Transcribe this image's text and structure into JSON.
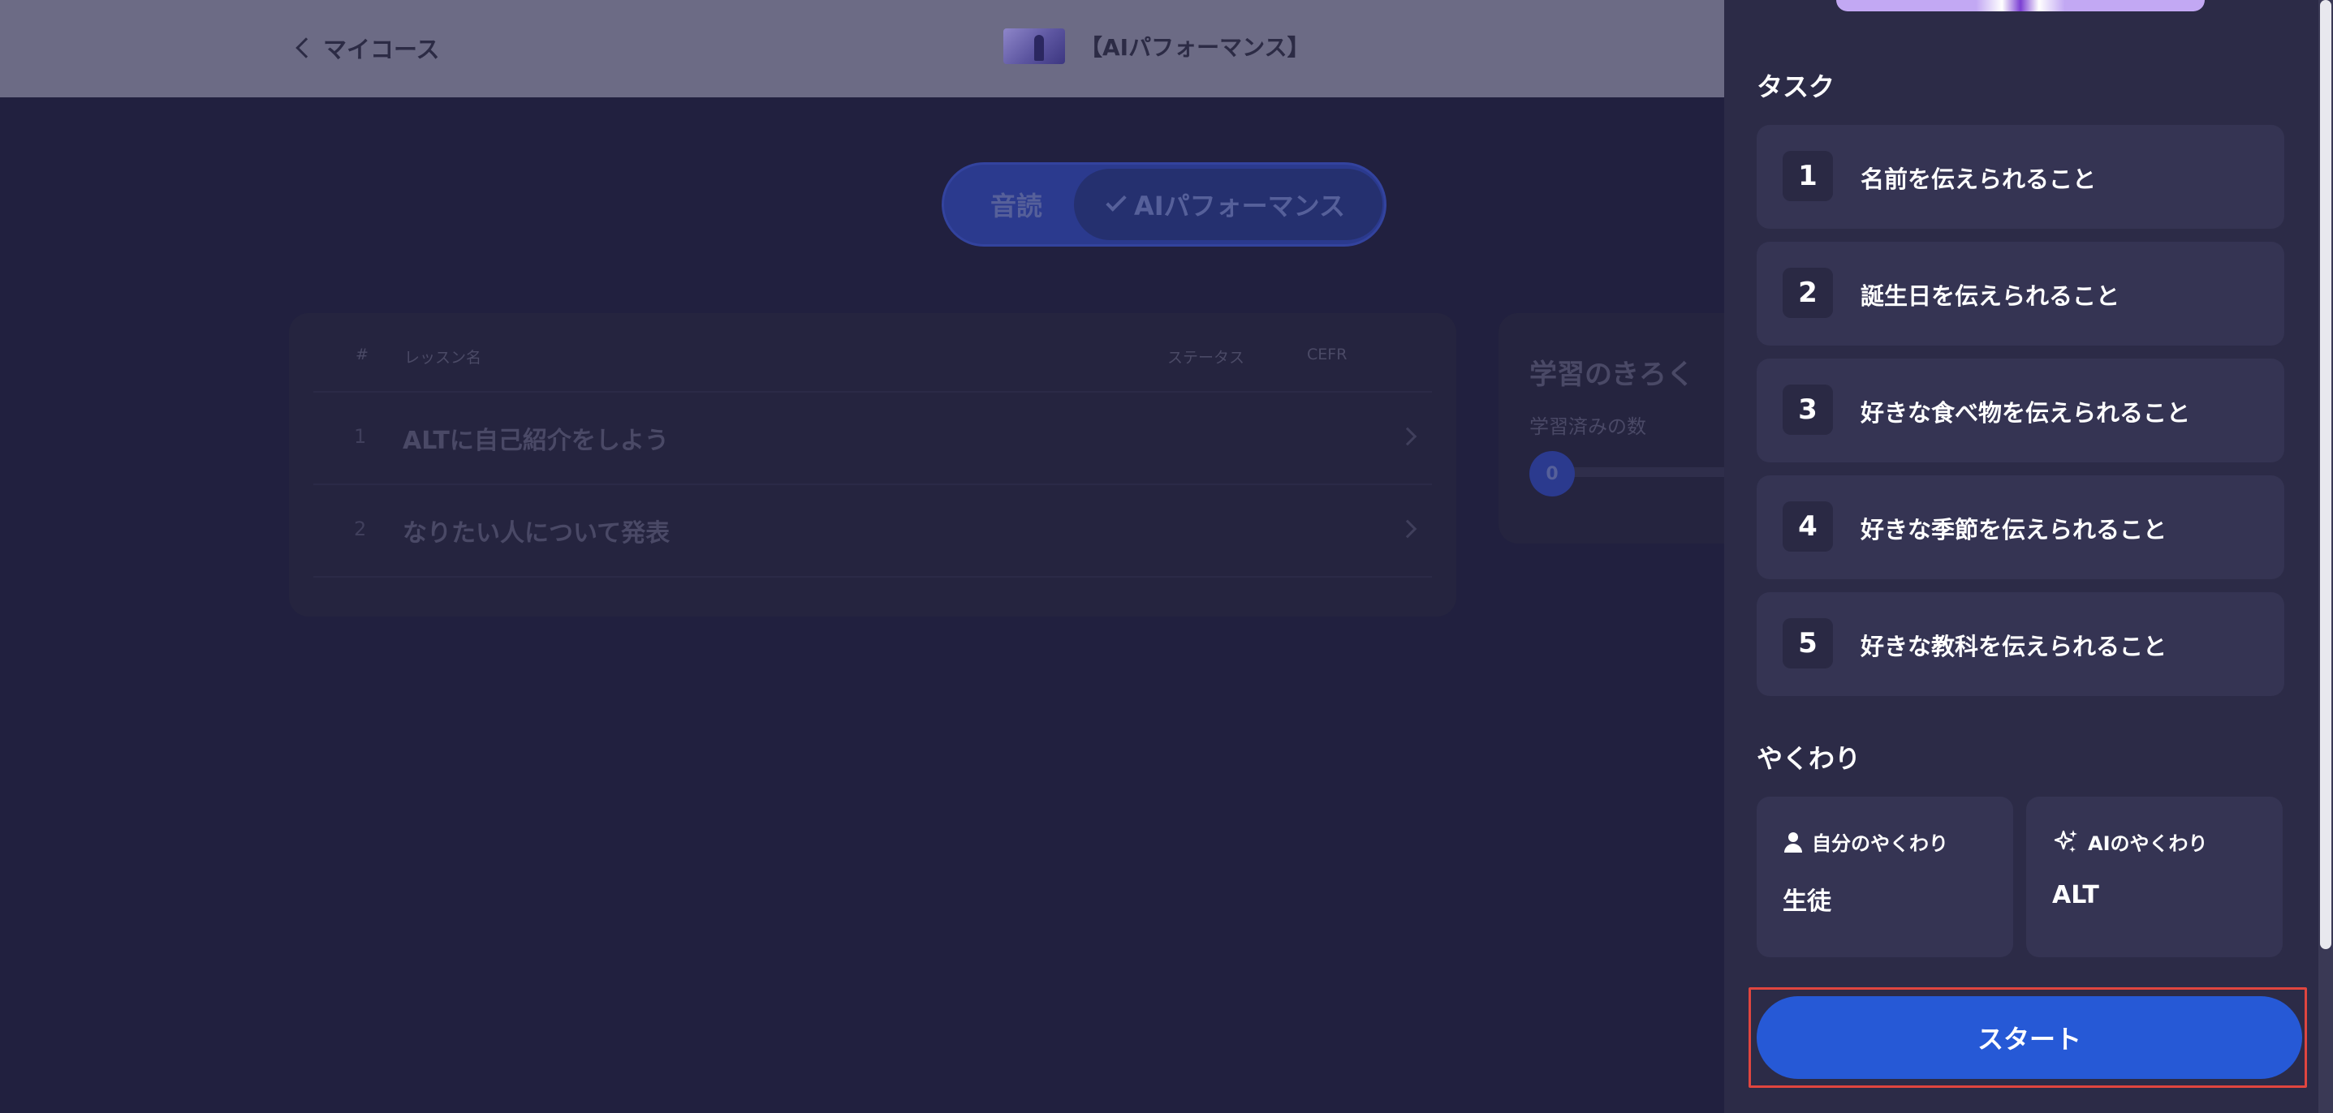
{
  "header": {
    "back_label": "マイコース",
    "course_title": "【AIパフォーマンス】"
  },
  "mode_toggle": {
    "reading_label": "音読",
    "ai_label": "AIパフォーマンス",
    "selected": "AIパフォーマンス"
  },
  "lesson_table": {
    "columns": [
      "#",
      "レッスン名",
      "ステータス",
      "CEFR"
    ],
    "rows": [
      {
        "num": "1",
        "name": "ALTに自己紹介をしよう"
      },
      {
        "num": "2",
        "name": "なりたい人について発表"
      }
    ]
  },
  "record": {
    "title": "学習のきろく",
    "subtitle": "学習済みの数",
    "count": "0"
  },
  "drawer": {
    "tasks_title": "タスク",
    "tasks": [
      {
        "num": "1",
        "text": "名前を伝えられること"
      },
      {
        "num": "2",
        "text": "誕生日を伝えられること"
      },
      {
        "num": "3",
        "text": "好きな食べ物を伝えられること"
      },
      {
        "num": "4",
        "text": "好きな季節を伝えられること"
      },
      {
        "num": "5",
        "text": "好きな教科を伝えられること"
      }
    ],
    "roles_title": "やくわり",
    "my_role": {
      "label": "自分のやくわり",
      "value": "生徒",
      "icon": "person-icon"
    },
    "ai_role": {
      "label": "AIのやくわり",
      "value": "ALT",
      "icon": "sparkle-icon"
    },
    "start_label": "スタート"
  },
  "colors": {
    "accent": "#2659d6",
    "highlight_border": "#e0453f",
    "drawer_bg": "#2c2b47",
    "card_bg": "#353453"
  }
}
